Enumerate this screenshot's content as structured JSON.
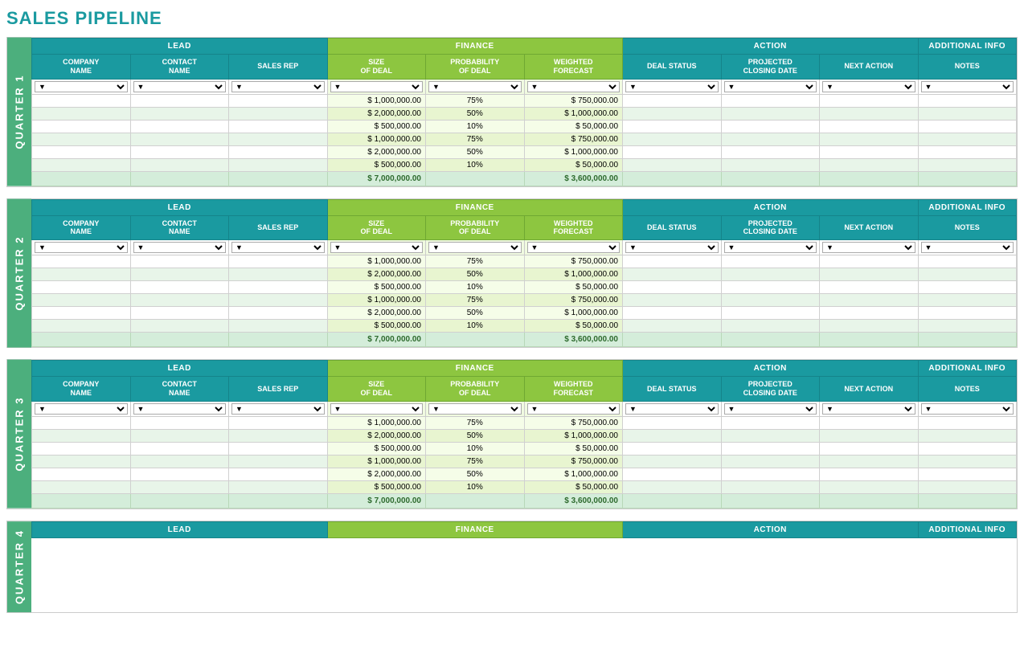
{
  "title": "SALES PIPELINE",
  "colors": {
    "teal": "#1a9aa0",
    "green": "#8dc640",
    "quarterBg": "#4caf7d",
    "totalRowBg": "#d4edda",
    "altRowBg": "#e8f5e9"
  },
  "sections": {
    "lead": "LEAD",
    "finance": "FINANCE",
    "action": "ACTION",
    "additionalInfo": "ADDITIONAL INFO"
  },
  "columns": {
    "companyName": "COMPANY NAME",
    "contactName": "CONTACT NAME",
    "salesRep": "SALES REP",
    "sizeOfDeal": "SIZE OF DEAL",
    "probabilityOfDeal": "PROBABILITY OF DEAL",
    "weightedForecast": "WEIGHTED FORECAST",
    "dealStatus": "DEAL STATUS",
    "projectedClosingDate": "PROJECTED CLOSING DATE",
    "nextAction": "NEXT ACTION",
    "notes": "NOTES"
  },
  "quarters": [
    {
      "label": "QUARTER 1",
      "rows": [
        {
          "sizeOfDeal": "$ 1,000,000.00",
          "prob": "75%",
          "weighted": "$ 750,000.00"
        },
        {
          "sizeOfDeal": "$ 2,000,000.00",
          "prob": "50%",
          "weighted": "$ 1,000,000.00"
        },
        {
          "sizeOfDeal": "$ 500,000.00",
          "prob": "10%",
          "weighted": "$ 50,000.00"
        },
        {
          "sizeOfDeal": "$ 1,000,000.00",
          "prob": "75%",
          "weighted": "$ 750,000.00"
        },
        {
          "sizeOfDeal": "$ 2,000,000.00",
          "prob": "50%",
          "weighted": "$ 1,000,000.00"
        },
        {
          "sizeOfDeal": "$ 500,000.00",
          "prob": "10%",
          "weighted": "$ 50,000.00"
        }
      ],
      "total": {
        "sizeOfDeal": "$ 7,000,000.00",
        "weighted": "$ 3,600,000.00"
      }
    },
    {
      "label": "QUARTER 2",
      "rows": [
        {
          "sizeOfDeal": "$ 1,000,000.00",
          "prob": "75%",
          "weighted": "$ 750,000.00"
        },
        {
          "sizeOfDeal": "$ 2,000,000.00",
          "prob": "50%",
          "weighted": "$ 1,000,000.00"
        },
        {
          "sizeOfDeal": "$ 500,000.00",
          "prob": "10%",
          "weighted": "$ 50,000.00"
        },
        {
          "sizeOfDeal": "$ 1,000,000.00",
          "prob": "75%",
          "weighted": "$ 750,000.00"
        },
        {
          "sizeOfDeal": "$ 2,000,000.00",
          "prob": "50%",
          "weighted": "$ 1,000,000.00"
        },
        {
          "sizeOfDeal": "$ 500,000.00",
          "prob": "10%",
          "weighted": "$ 50,000.00"
        }
      ],
      "total": {
        "sizeOfDeal": "$ 7,000,000.00",
        "weighted": "$ 3,600,000.00"
      }
    },
    {
      "label": "QUARTER 3",
      "rows": [
        {
          "sizeOfDeal": "$ 1,000,000.00",
          "prob": "75%",
          "weighted": "$ 750,000.00"
        },
        {
          "sizeOfDeal": "$ 2,000,000.00",
          "prob": "50%",
          "weighted": "$ 1,000,000.00"
        },
        {
          "sizeOfDeal": "$ 500,000.00",
          "prob": "10%",
          "weighted": "$ 50,000.00"
        },
        {
          "sizeOfDeal": "$ 1,000,000.00",
          "prob": "75%",
          "weighted": "$ 750,000.00"
        },
        {
          "sizeOfDeal": "$ 2,000,000.00",
          "prob": "50%",
          "weighted": "$ 1,000,000.00"
        },
        {
          "sizeOfDeal": "$ 500,000.00",
          "prob": "10%",
          "weighted": "$ 50,000.00"
        }
      ],
      "total": {
        "sizeOfDeal": "$ 7,000,000.00",
        "weighted": "$ 3,600,000.00"
      }
    },
    {
      "label": "QUARTER 4",
      "rows": [],
      "total": null
    }
  ]
}
